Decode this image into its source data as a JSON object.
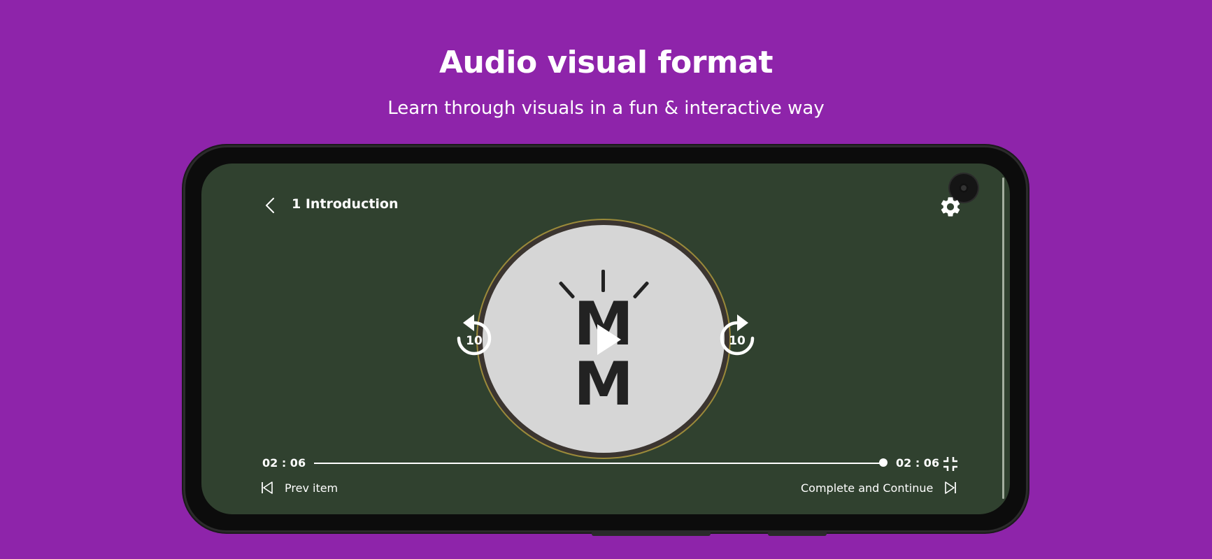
{
  "header": {
    "title": "Audio visual format",
    "subtitle": "Learn through visuals in a fun & interactive way"
  },
  "player": {
    "lesson_title": "1 Introduction",
    "artwork_letters": [
      "M",
      "M"
    ],
    "skip_back_seconds": "10",
    "skip_forward_seconds": "10",
    "current_time": "02 : 06",
    "total_time": "02 : 06",
    "progress_fraction": 1.0,
    "prev_label": "Prev item",
    "next_label": "Complete and Continue"
  },
  "icons": {
    "back": "chevron-left-icon",
    "settings": "gear-icon",
    "play": "play-icon",
    "rewind": "replay-10-icon",
    "forward": "forward-10-icon",
    "fullscreen_exit": "fullscreen-exit-icon",
    "prev": "skip-previous-icon",
    "next": "skip-next-icon"
  },
  "colors": {
    "background": "#8e24aa",
    "screen": "#30412f",
    "text": "#ffffff"
  }
}
